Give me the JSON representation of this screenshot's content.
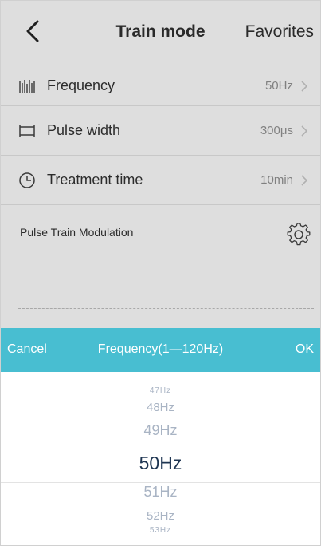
{
  "header": {
    "back_icon": "chevron-left-icon",
    "title": "Train mode",
    "favorites": "Favorites"
  },
  "settings": [
    {
      "icon": "frequency-icon",
      "label": "Frequency",
      "value": "50Hz"
    },
    {
      "icon": "pulse-width-icon",
      "label": "Pulse width",
      "value": "300μs"
    },
    {
      "icon": "clock-icon",
      "label": "Treatment time",
      "value": "10min"
    }
  ],
  "modulation": {
    "label": "Pulse Train Modulation",
    "icon": "gear-icon"
  },
  "picker": {
    "cancel": "Cancel",
    "title": "Frequency(1—120Hz)",
    "ok": "OK",
    "options": [
      "47Hz",
      "48Hz",
      "49Hz",
      "50Hz",
      "51Hz",
      "52Hz",
      "53Hz"
    ],
    "selected": "50Hz"
  },
  "colors": {
    "accent": "#48bed1",
    "dim_background": "#dedede",
    "option_text": "#a9b4c4",
    "selected_text": "#1e3552"
  }
}
